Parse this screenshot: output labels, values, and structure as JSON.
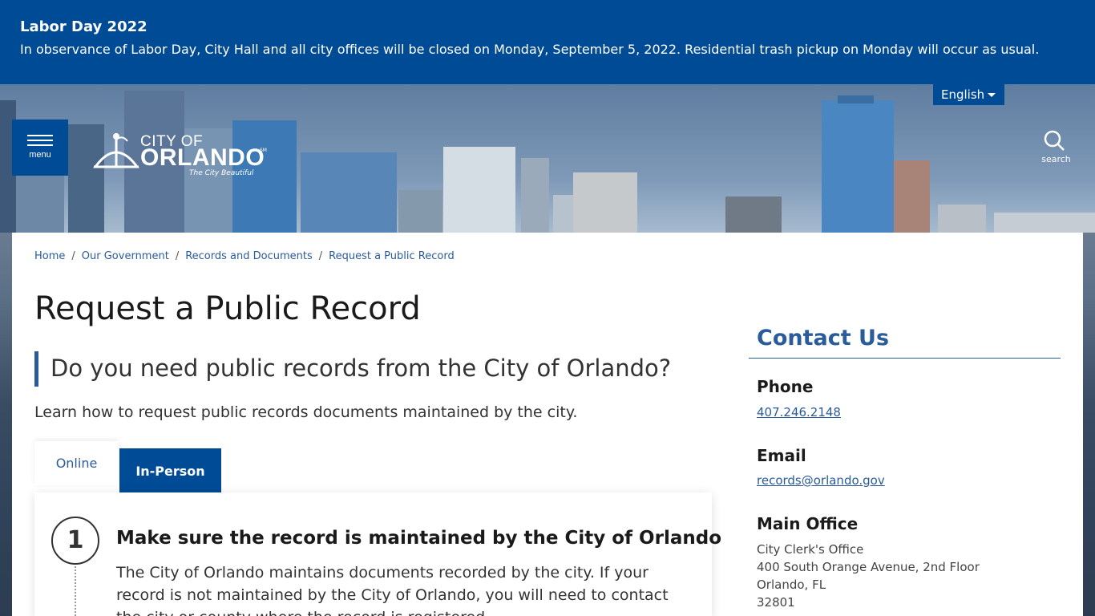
{
  "alert": {
    "title": "Labor Day 2022",
    "text": "In observance of Labor Day, City Hall and all city offices will be closed on Monday, September 5, 2022. Residential trash pickup on Monday will occur as usual."
  },
  "header": {
    "language": "English",
    "menu_label": "menu",
    "search_label": "search",
    "logo": {
      "line1": "CITY OF",
      "line2": "ORLANDO",
      "mark": "SM",
      "tagline": "The City Beautiful"
    }
  },
  "breadcrumb": [
    "Home",
    "Our Government",
    "Records and Documents",
    "Request a Public Record"
  ],
  "page": {
    "title": "Request a Public Record",
    "lead": "Do you need public records from the City of Orlando?",
    "intro": "Learn how to request public records documents maintained by the city."
  },
  "tabs": [
    {
      "label": "Online",
      "active": true
    },
    {
      "label": "In-Person",
      "active": false
    }
  ],
  "steps": [
    {
      "number": "1",
      "title": "Make sure the record is maintained by the City of Orlando",
      "text": "The City of Orlando maintains documents recorded by the city. If your record is not maintained by the City of Orlando, you will need to contact the city or county where the record is registered."
    }
  ],
  "contact": {
    "heading": "Contact Us",
    "phone_label": "Phone",
    "phone": "407.246.2148",
    "email_label": "Email",
    "email": "records@orlando.gov",
    "office_label": "Main Office",
    "office_lines": [
      "City Clerk's Office",
      "400 South Orange Avenue, 2nd Floor",
      "Orlando, FL",
      "32801"
    ]
  },
  "colors": {
    "brand": "#004b96",
    "link": "#2a5b9a"
  }
}
